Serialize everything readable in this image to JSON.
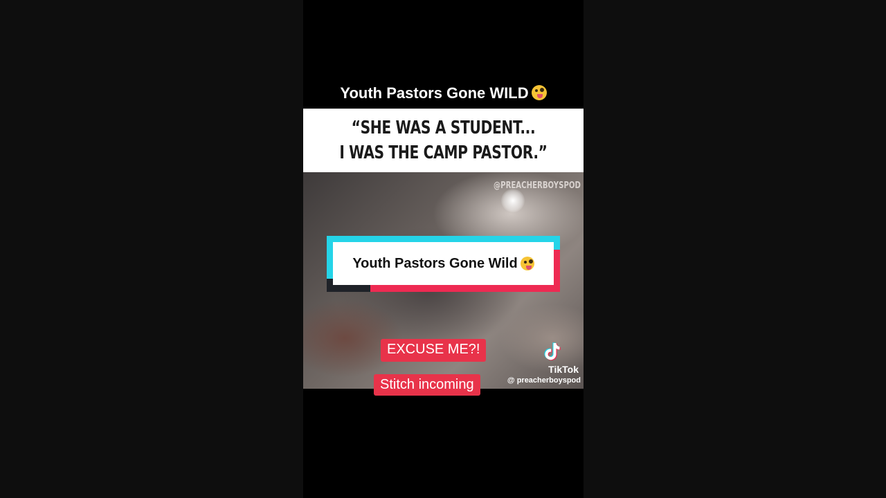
{
  "video": {
    "top_title": "Youth Pastors Gone WILD",
    "top_title_emoji": "zany-face-emoji",
    "quote": "“SHE WAS A STUDENT...\nI WAS THE CAMP PASTOR.”",
    "watermark": "@PREACHERBOYSPOD",
    "stitch_card_title": "Youth Pastors Gone Wild",
    "stitch_card_emoji": "zany-face-emoji",
    "caption_1": "EXCUSE ME?!",
    "caption_2": "Stitch incoming",
    "tiktok_brand": "TikTok",
    "tiktok_handle": "@ preacherboyspod"
  },
  "colors": {
    "page_background": "#0e0e0e",
    "video_background": "#000000",
    "caption_red": "#e8334a",
    "card_cyan": "#25d4e8",
    "card_red": "#ee2a52",
    "emoji_yellow": "#f6c335"
  }
}
